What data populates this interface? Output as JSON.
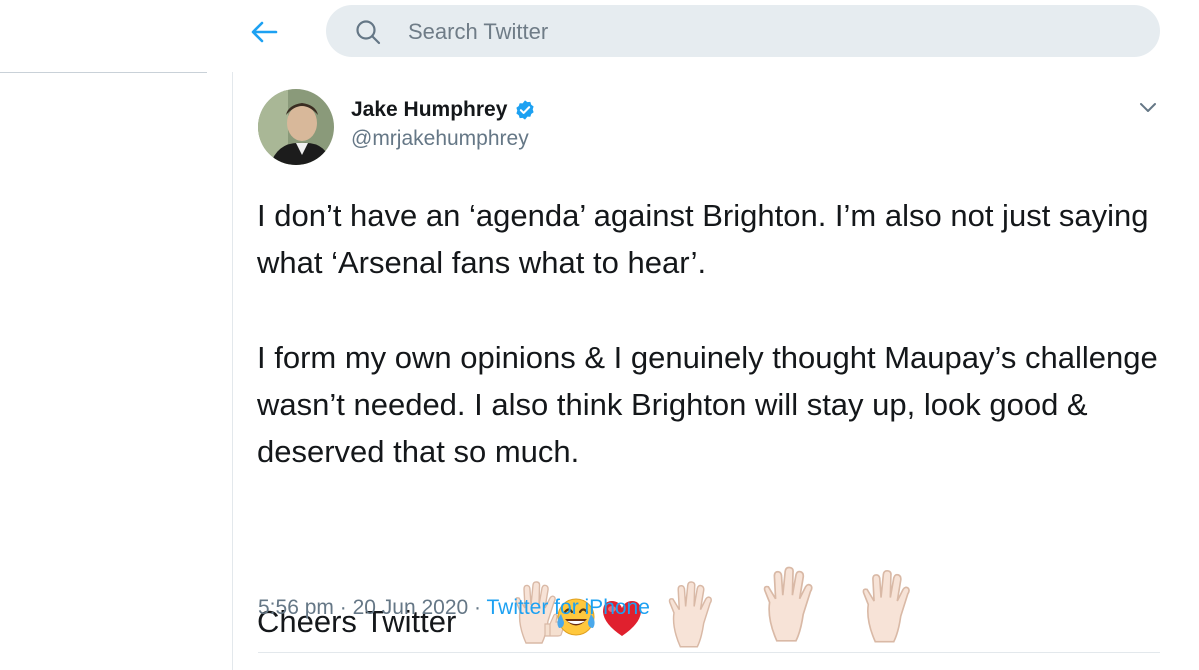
{
  "header": {
    "search_placeholder": "Search Twitter",
    "accent_color": "#1da1f2"
  },
  "tweet": {
    "author_name": "Jake Humphrey",
    "handle": "@mrjakehumphrey",
    "verified": true,
    "paragraphs": [
      "I don’t have an ‘agenda’ against Brighton. I’m also not just saying what ‘Arsenal fans what to hear’.",
      "I form my own opinions & I genuinely thought Maupay’s challenge wasn’t needed. I also think Brighton will stay up, look good & deserved that so much."
    ],
    "closing": "Cheers Twitter",
    "emojis": [
      "raised-hand-emoji",
      "thumbs-up-emoji",
      "tears-of-joy-emoji",
      "red-heart-emoji",
      "raised-hand-emoji",
      "raised-hand-emoji",
      "raised-hand-emoji"
    ],
    "time": "5:56 pm",
    "separator": "·",
    "date": "20 Jun 2020",
    "source": "Twitter for iPhone"
  }
}
